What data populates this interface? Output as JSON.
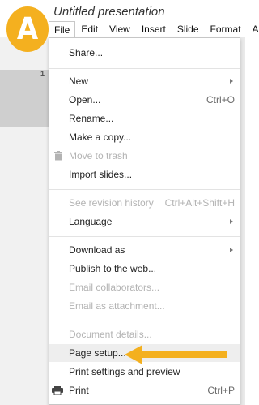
{
  "document": {
    "title": "Untitled presentation"
  },
  "badge": {
    "letter": "A",
    "color": "#f4b01f"
  },
  "menubar": {
    "items": [
      {
        "label": "File",
        "active": true
      },
      {
        "label": "Edit"
      },
      {
        "label": "View"
      },
      {
        "label": "Insert"
      },
      {
        "label": "Slide"
      },
      {
        "label": "Format"
      },
      {
        "label": "A"
      }
    ]
  },
  "slides": {
    "current_number": "1"
  },
  "file_menu": {
    "share": "Share...",
    "new": "New",
    "open": {
      "label": "Open...",
      "shortcut": "Ctrl+O"
    },
    "rename": "Rename...",
    "make_copy": "Make a copy...",
    "move_to_trash": "Move to trash",
    "import_slides": "Import slides...",
    "revision_history": {
      "label": "See revision history",
      "shortcut": "Ctrl+Alt+Shift+H"
    },
    "language": "Language",
    "download_as": "Download as",
    "publish": "Publish to the web...",
    "email_collaborators": "Email collaborators...",
    "email_attachment": "Email as attachment...",
    "document_details": "Document details...",
    "page_setup": "Page setup...",
    "print_settings": "Print settings and preview",
    "print": {
      "label": "Print",
      "shortcut": "Ctrl+P"
    }
  },
  "colors": {
    "accent": "#f4b01f",
    "disabled_text": "#b3b3b3",
    "hover_bg": "#eeeeee"
  },
  "icons": {
    "trash": "trash-icon",
    "printer": "printer-icon",
    "arrow": "arrow-left-icon",
    "submenu": "submenu-arrow-icon"
  }
}
